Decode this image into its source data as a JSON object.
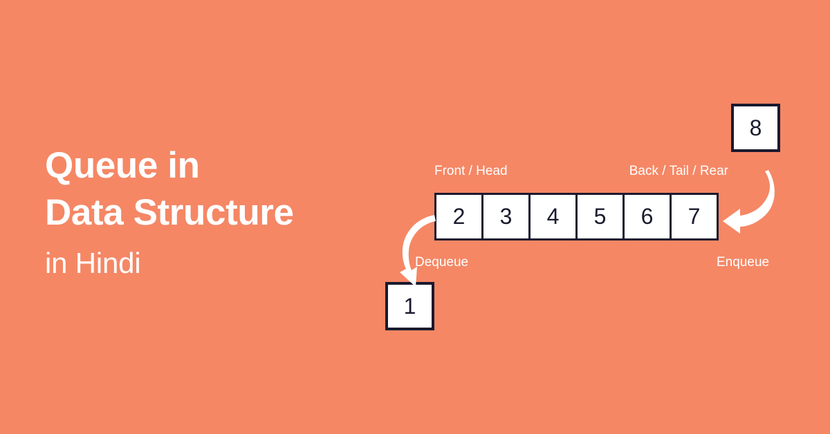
{
  "background_color": "#F58765",
  "ink_color": "#1A1A2E",
  "text_color": "#FFFFFF",
  "title": {
    "main": "Queue in\nData Structure",
    "sub": "in Hindi"
  },
  "diagram": {
    "front_label": "Front / Head",
    "back_label": "Back / Tail / Rear",
    "queue_values": [
      "2",
      "3",
      "4",
      "5",
      "6",
      "7"
    ],
    "incoming_value": "8",
    "outgoing_value": "1",
    "enqueue_label": "Enqueue",
    "dequeue_label": "Dequeue"
  }
}
